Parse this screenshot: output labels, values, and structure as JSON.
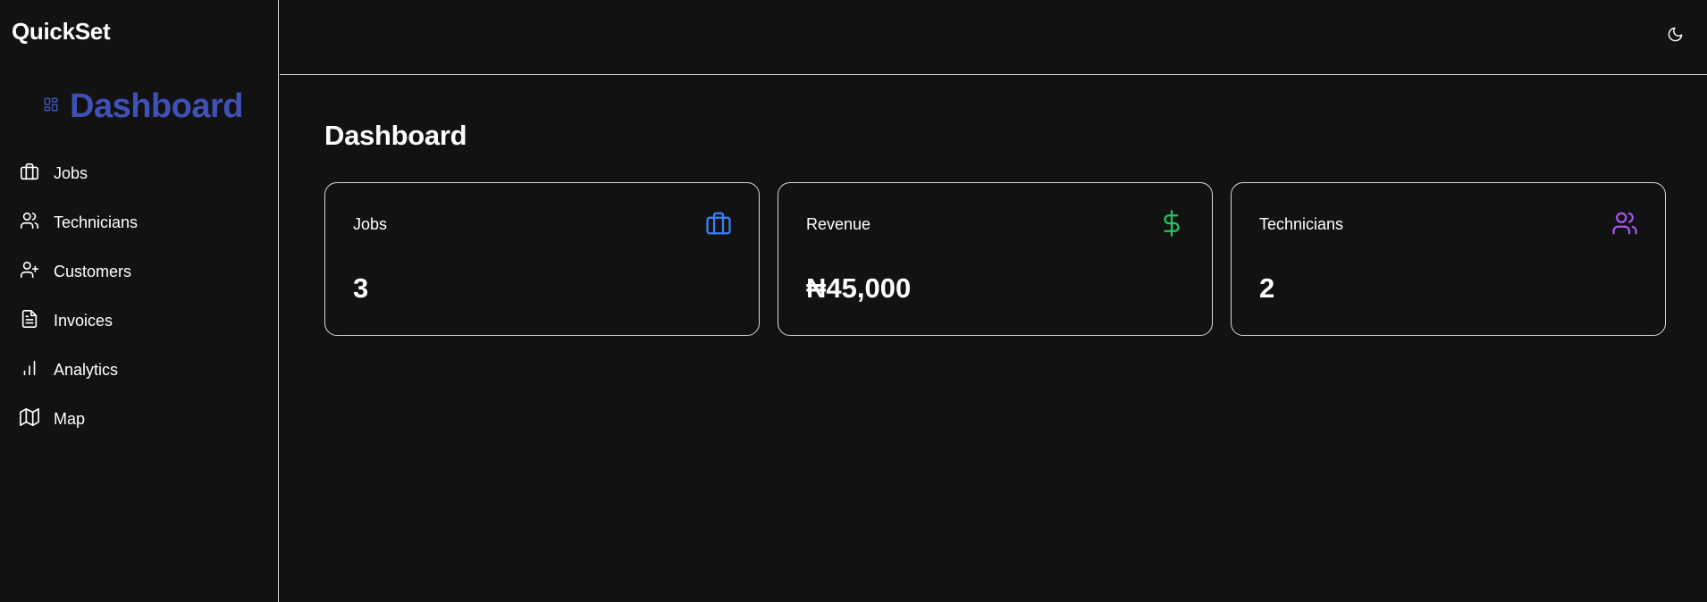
{
  "app": {
    "brand": "QuickSet"
  },
  "sidebar": {
    "active": {
      "label": "Dashboard",
      "icon": "layout-grid-icon",
      "color": "#3f51b5"
    },
    "items": [
      {
        "label": "Jobs",
        "icon": "briefcase-icon"
      },
      {
        "label": "Technicians",
        "icon": "users-icon"
      },
      {
        "label": "Customers",
        "icon": "user-plus-icon"
      },
      {
        "label": "Invoices",
        "icon": "file-text-icon"
      },
      {
        "label": "Analytics",
        "icon": "bar-chart-icon"
      },
      {
        "label": "Map",
        "icon": "map-icon"
      }
    ]
  },
  "topbar": {
    "theme_toggle_icon": "moon-icon"
  },
  "main": {
    "title": "Dashboard",
    "cards": [
      {
        "title": "Jobs",
        "value": "3",
        "icon": "briefcase-icon",
        "color": "#3b82f6"
      },
      {
        "title": "Revenue",
        "value": "₦45,000",
        "icon": "dollar-sign-icon",
        "color": "#22c55e"
      },
      {
        "title": "Technicians",
        "value": "2",
        "icon": "users-icon",
        "color": "#a855f7"
      }
    ]
  },
  "theme": {
    "background": "#121212",
    "border": "#d9d9d9",
    "text": "#ffffff"
  }
}
